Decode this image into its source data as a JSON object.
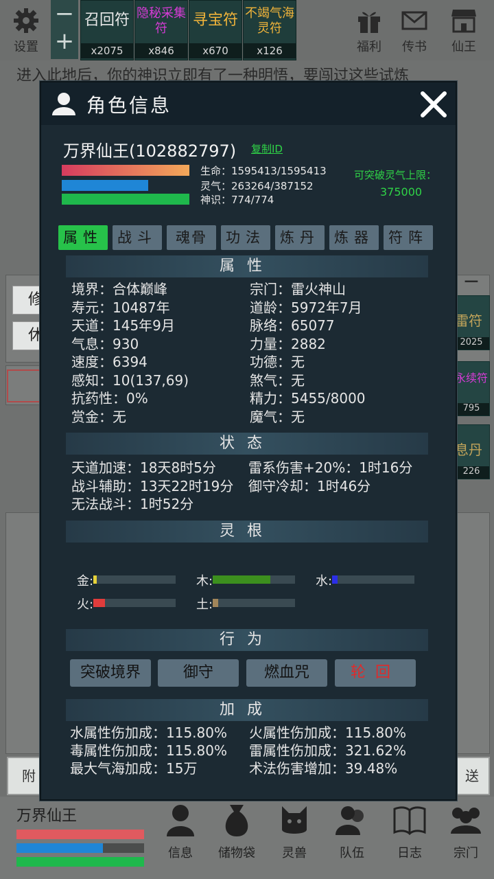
{
  "topbar": {
    "settings_label": "设置",
    "welfare_label": "福利",
    "mail_label": "传书",
    "immortal_label": "仙王",
    "talismans": [
      {
        "name": "召回符",
        "count": "x2075",
        "color": "#e8e8e8"
      },
      {
        "name": "隐秘采集符",
        "count": "x846",
        "color": "#d63bd6"
      },
      {
        "name": "寻宝符",
        "count": "x670",
        "color": "#f1b43a"
      },
      {
        "name": "不竭气海灵符",
        "count": "x126",
        "color": "#f1b43a"
      }
    ]
  },
  "background": {
    "story_text": "进入此地后，你的神识立即有了一种明悟，要闯过这些试炼",
    "btn_cultivate": "修",
    "btn_rest": "休",
    "side_cards": [
      {
        "name": "雷符",
        "count": "2025"
      },
      {
        "name": "永续符",
        "count": "795"
      },
      {
        "name": "息丹",
        "count": "226"
      }
    ],
    "attach_label": "附",
    "send_label": "送"
  },
  "dialog": {
    "title": "角色信息",
    "hero_name": "万界仙王(102882797)",
    "copy_id": "复制ID",
    "hp_text": "生命：1595413/1595413",
    "mp_text": "灵气：263264/387152",
    "sense_text": "神识：774/774",
    "hp_ratio": 1.0,
    "mp_ratio": 0.68,
    "sense_ratio": 1.0,
    "break_label": "可突破灵气上限：",
    "break_value": "375000",
    "tabs": [
      "属性",
      "战斗",
      "魂骨",
      "功法",
      "炼丹",
      "炼器",
      "符阵"
    ],
    "active_tab": 0,
    "sections": {
      "attributes": "属性",
      "status": "状态",
      "roots": "灵根",
      "actions": "行为",
      "bonus": "加成"
    },
    "attributes": [
      [
        "境界：合体巅峰",
        "宗门：雷火神山"
      ],
      [
        "寿元：10487年",
        "道龄：5972年7月"
      ],
      [
        "天道：145年9月",
        "脉络：65077"
      ],
      [
        "气息：930",
        "力量：2882"
      ],
      [
        "速度：6394",
        "功德：无"
      ],
      [
        "感知：10(137,69)",
        "煞气：无"
      ],
      [
        "抗药性：0%",
        "精力：5455/8000"
      ],
      [
        "赏金：无",
        "魔气：无"
      ]
    ],
    "status": [
      [
        "天道加速：18天8时5分",
        "雷系伤害+20%：1时16分"
      ],
      [
        "战斗辅助：13天22时19分",
        "御守冷却：1时46分"
      ],
      [
        "无法战斗：1时52分",
        ""
      ]
    ],
    "roots": [
      {
        "label": "金:",
        "value": 0.04,
        "color": "#e6d23a"
      },
      {
        "label": "木:",
        "value": 0.7,
        "color": "#3c8f1e"
      },
      {
        "label": "水:",
        "value": 0.07,
        "color": "#2b2ee6"
      },
      {
        "label": "火:",
        "value": 0.14,
        "color": "#e03c3c"
      },
      {
        "label": "土:",
        "value": 0.07,
        "color": "#a0855a"
      }
    ],
    "actions": [
      "突破境界",
      "御守",
      "燃血咒",
      "轮回"
    ],
    "bonus": [
      [
        "水属性伤加成：115.80%",
        "火属性伤加成：115.80%"
      ],
      [
        "毒属性伤加成：115.80%",
        "雷属性伤加成：321.62%"
      ],
      [
        "最大气海加成：15万",
        "术法伤害增加：39.48%"
      ]
    ]
  },
  "bottom": {
    "player_name": "万界仙王",
    "hp_ratio": 1.0,
    "mp_ratio": 0.68,
    "sense_ratio": 1.0,
    "nav": [
      "信息",
      "储物袋",
      "灵兽",
      "队伍",
      "日志",
      "宗门"
    ]
  },
  "colors": {
    "hp": "#e05a5f",
    "mp": "#1f86d6",
    "sense": "#1fb84c",
    "active_tab": "#27c24a",
    "reincarnate": "#e02a2a"
  }
}
